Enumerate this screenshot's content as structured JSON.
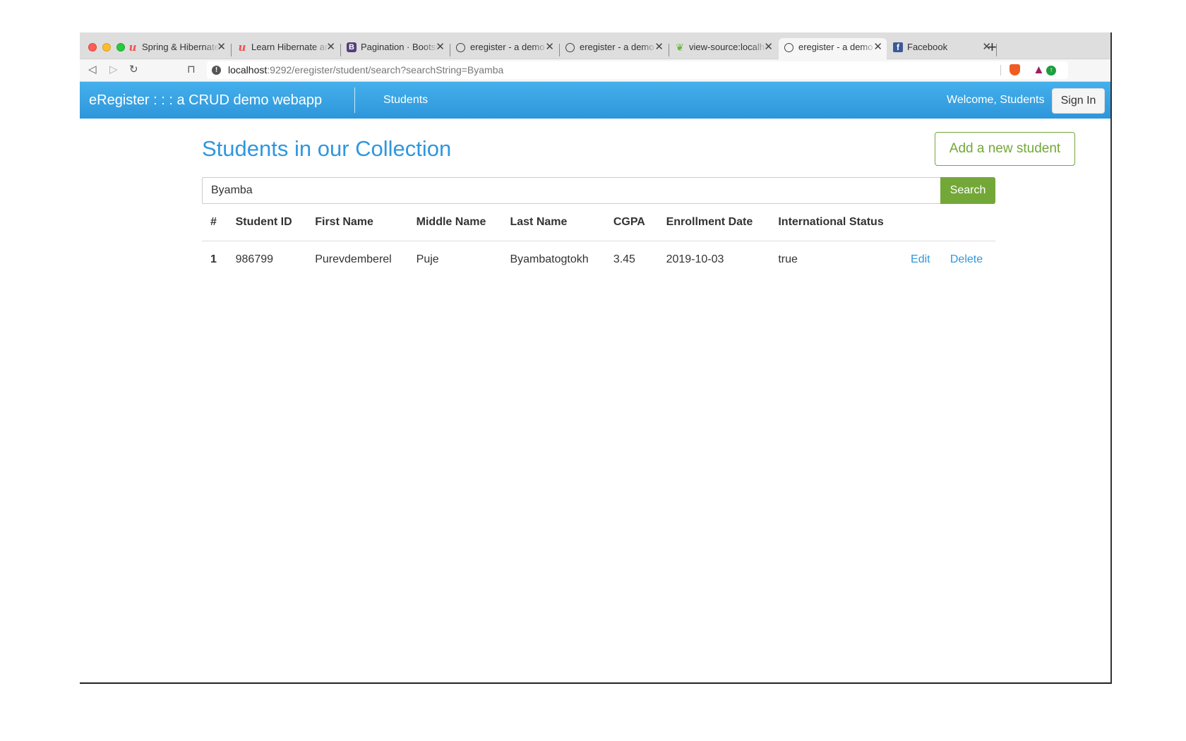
{
  "browser": {
    "tabs": [
      {
        "label": "Spring & Hibernate",
        "icon": "udemy-icon",
        "active": false
      },
      {
        "label": "Learn Hibernate and",
        "icon": "udemy-icon",
        "active": false
      },
      {
        "label": "Pagination · Bootstrap",
        "icon": "bootstrap-icon",
        "active": false
      },
      {
        "label": "eregister - a demo",
        "icon": "globe-icon",
        "active": false
      },
      {
        "label": "eregister - a demo",
        "icon": "globe-icon",
        "active": false
      },
      {
        "label": "view-source:localhost",
        "icon": "spring-leaf-icon",
        "active": false
      },
      {
        "label": "eregister - a demo",
        "icon": "globe-icon",
        "active": true
      },
      {
        "label": "Facebook",
        "icon": "facebook-icon",
        "active": false
      }
    ],
    "url_host": "localhost",
    "url_rest": ":9292/eregister/student/search?searchString=Byamba"
  },
  "navbar": {
    "brand": "eRegister : : : a CRUD demo webapp",
    "nav_students": "Students",
    "welcome": "Welcome, Students",
    "signin": "Sign In",
    "bg_color": "#3aa3e3"
  },
  "main": {
    "title": "Students in our Collection",
    "add_button": "Add a new student",
    "search_value": "Byamba",
    "search_button": "Search",
    "accent_green": "#73a839",
    "accent_blue": "#2f97de"
  },
  "table": {
    "headers": [
      "#",
      "Student ID",
      "First Name",
      "Middle Name",
      "Last Name",
      "CGPA",
      "Enrollment Date",
      "International Status"
    ],
    "rows": [
      {
        "num": "1",
        "student_id": "986799",
        "first_name": "Purevdemberel",
        "middle_name": "Puje",
        "last_name": "Byambatogtokh",
        "cgpa": "3.45",
        "enrollment_date": "2019-10-03",
        "international": "true",
        "edit": "Edit",
        "delete": "Delete"
      }
    ]
  }
}
